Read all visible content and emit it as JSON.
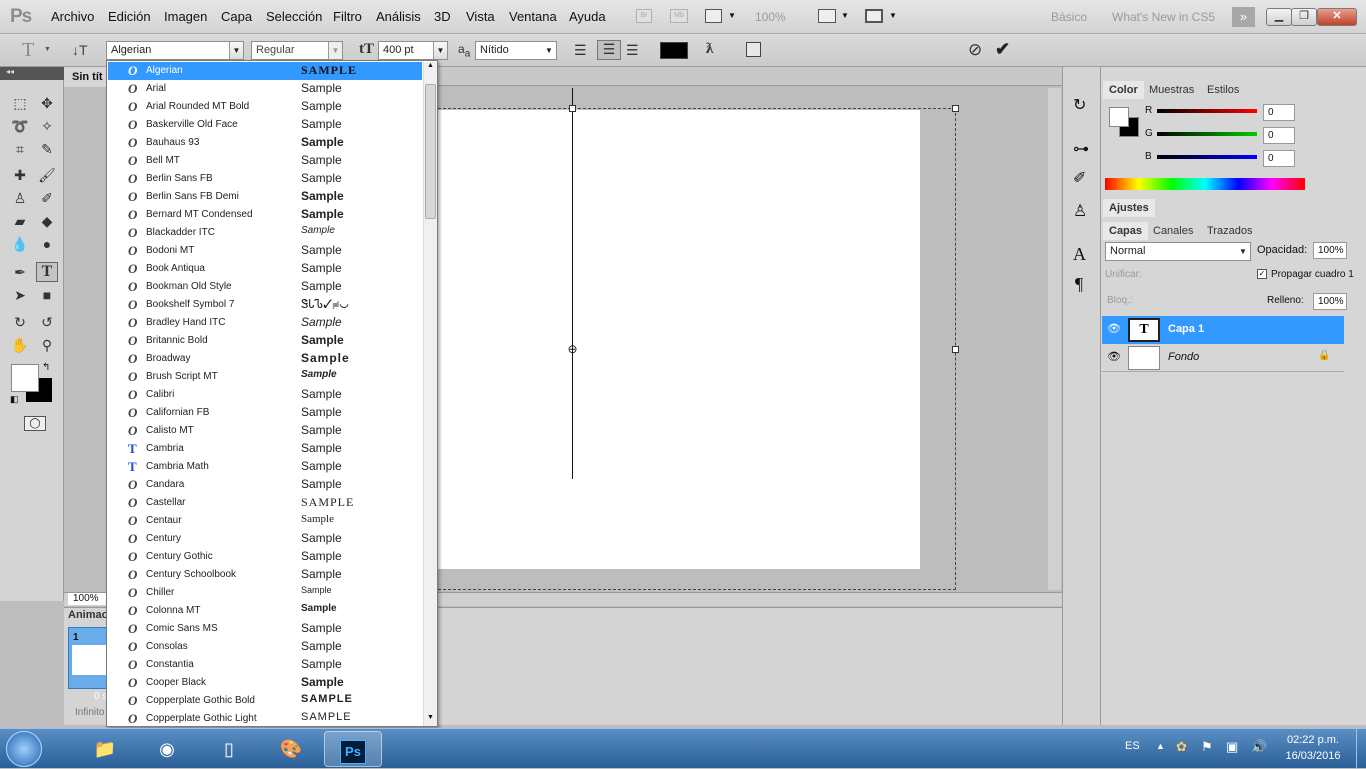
{
  "menubar": {
    "logo": "Ps",
    "items": [
      "Archivo",
      "Edición",
      "Imagen",
      "Capa",
      "Selección",
      "Filtro",
      "Análisis",
      "3D",
      "Vista",
      "Ventana",
      "Ayuda"
    ],
    "zoom": "100%",
    "workspace": "Básico",
    "whats_new": "What's New in CS5",
    "window_buttons": [
      "minimize",
      "restore",
      "close"
    ]
  },
  "options": {
    "tool_icon": "T",
    "font_family": "Algerian",
    "font_style": "Regular",
    "font_size": "400 pt",
    "aa_label": "a",
    "aa_sub": "a",
    "antialias": "Nítido",
    "color": "#000000"
  },
  "document": {
    "tab_title": "Sin tít",
    "zoom_readout": "100%",
    "animation_label": "Animac",
    "frame_number": "1",
    "frame_time": "0 s",
    "loop": "Infinito"
  },
  "font_list": [
    {
      "name": "Algerian",
      "sample": "SAMPLE",
      "icon": "O",
      "selected": true
    },
    {
      "name": "Arial",
      "sample": "Sample",
      "icon": "O"
    },
    {
      "name": "Arial Rounded MT Bold",
      "sample": "Sample",
      "icon": "O"
    },
    {
      "name": "Baskerville Old Face",
      "sample": "Sample",
      "icon": "O"
    },
    {
      "name": "Bauhaus 93",
      "sample": "Sample",
      "icon": "O"
    },
    {
      "name": "Bell MT",
      "sample": "Sample",
      "icon": "O"
    },
    {
      "name": "Berlin Sans FB",
      "sample": "Sample",
      "icon": "O"
    },
    {
      "name": "Berlin Sans FB Demi",
      "sample": "Sample",
      "icon": "O"
    },
    {
      "name": "Bernard MT Condensed",
      "sample": "Sample",
      "icon": "O"
    },
    {
      "name": "Blackadder ITC",
      "sample": "Sample",
      "icon": "O"
    },
    {
      "name": "Bodoni MT",
      "sample": "Sample",
      "icon": "O"
    },
    {
      "name": "Book Antiqua",
      "sample": "Sample",
      "icon": "O"
    },
    {
      "name": "Bookman Old Style",
      "sample": "Sample",
      "icon": "O"
    },
    {
      "name": "Bookshelf Symbol 7",
      "sample": "ᏕᏓᏖ✓≓◡",
      "icon": "O"
    },
    {
      "name": "Bradley Hand ITC",
      "sample": "Sample",
      "icon": "O"
    },
    {
      "name": "Britannic Bold",
      "sample": "Sample",
      "icon": "O"
    },
    {
      "name": "Broadway",
      "sample": "Sample",
      "icon": "O"
    },
    {
      "name": "Brush Script MT",
      "sample": "Sample",
      "icon": "O"
    },
    {
      "name": "Calibri",
      "sample": "Sample",
      "icon": "O"
    },
    {
      "name": "Californian FB",
      "sample": "Sample",
      "icon": "O"
    },
    {
      "name": "Calisto MT",
      "sample": "Sample",
      "icon": "O"
    },
    {
      "name": "Cambria",
      "sample": "Sample",
      "icon": "T"
    },
    {
      "name": "Cambria Math",
      "sample": "Sample",
      "icon": "T"
    },
    {
      "name": "Candara",
      "sample": "Sample",
      "icon": "O"
    },
    {
      "name": "Castellar",
      "sample": "SAMPLE",
      "icon": "O"
    },
    {
      "name": "Centaur",
      "sample": "Sample",
      "icon": "O"
    },
    {
      "name": "Century",
      "sample": "Sample",
      "icon": "O"
    },
    {
      "name": "Century Gothic",
      "sample": "Sample",
      "icon": "O"
    },
    {
      "name": "Century Schoolbook",
      "sample": "Sample",
      "icon": "O"
    },
    {
      "name": "Chiller",
      "sample": "Sample",
      "icon": "O"
    },
    {
      "name": "Colonna MT",
      "sample": "Sample",
      "icon": "O"
    },
    {
      "name": "Comic Sans MS",
      "sample": "Sample",
      "icon": "O"
    },
    {
      "name": "Consolas",
      "sample": "Sample",
      "icon": "O"
    },
    {
      "name": "Constantia",
      "sample": "Sample",
      "icon": "O"
    },
    {
      "name": "Cooper Black",
      "sample": "Sample",
      "icon": "O"
    },
    {
      "name": "Copperplate Gothic Bold",
      "sample": "SAMPLE",
      "icon": "O"
    },
    {
      "name": "Copperplate Gothic Light",
      "sample": "SAMPLE",
      "icon": "O"
    }
  ],
  "color_panel": {
    "tabs": [
      "Color",
      "Muestras",
      "Estilos"
    ],
    "r_label": "R",
    "g_label": "G",
    "b_label": "B",
    "r": "0",
    "g": "0",
    "b": "0"
  },
  "adjust_panel": {
    "title": "Ajustes"
  },
  "layers_panel": {
    "tabs": [
      "Capas",
      "Canales",
      "Trazados"
    ],
    "blend_mode": "Normal",
    "opacity_label": "Opacidad:",
    "opacity": "100%",
    "unify_label": "Unificar:",
    "propagate_label": "Propagar cuadro 1",
    "lock_label": "Bloq.:",
    "fill_label": "Relleno:",
    "fill": "100%",
    "layers": [
      {
        "name": "Capa 1",
        "thumb": "T"
      },
      {
        "name": "Fondo"
      }
    ]
  },
  "taskbar": {
    "language": "ES",
    "time": "02:22 p.m.",
    "date": "16/03/2016",
    "ps_label": "Ps"
  }
}
